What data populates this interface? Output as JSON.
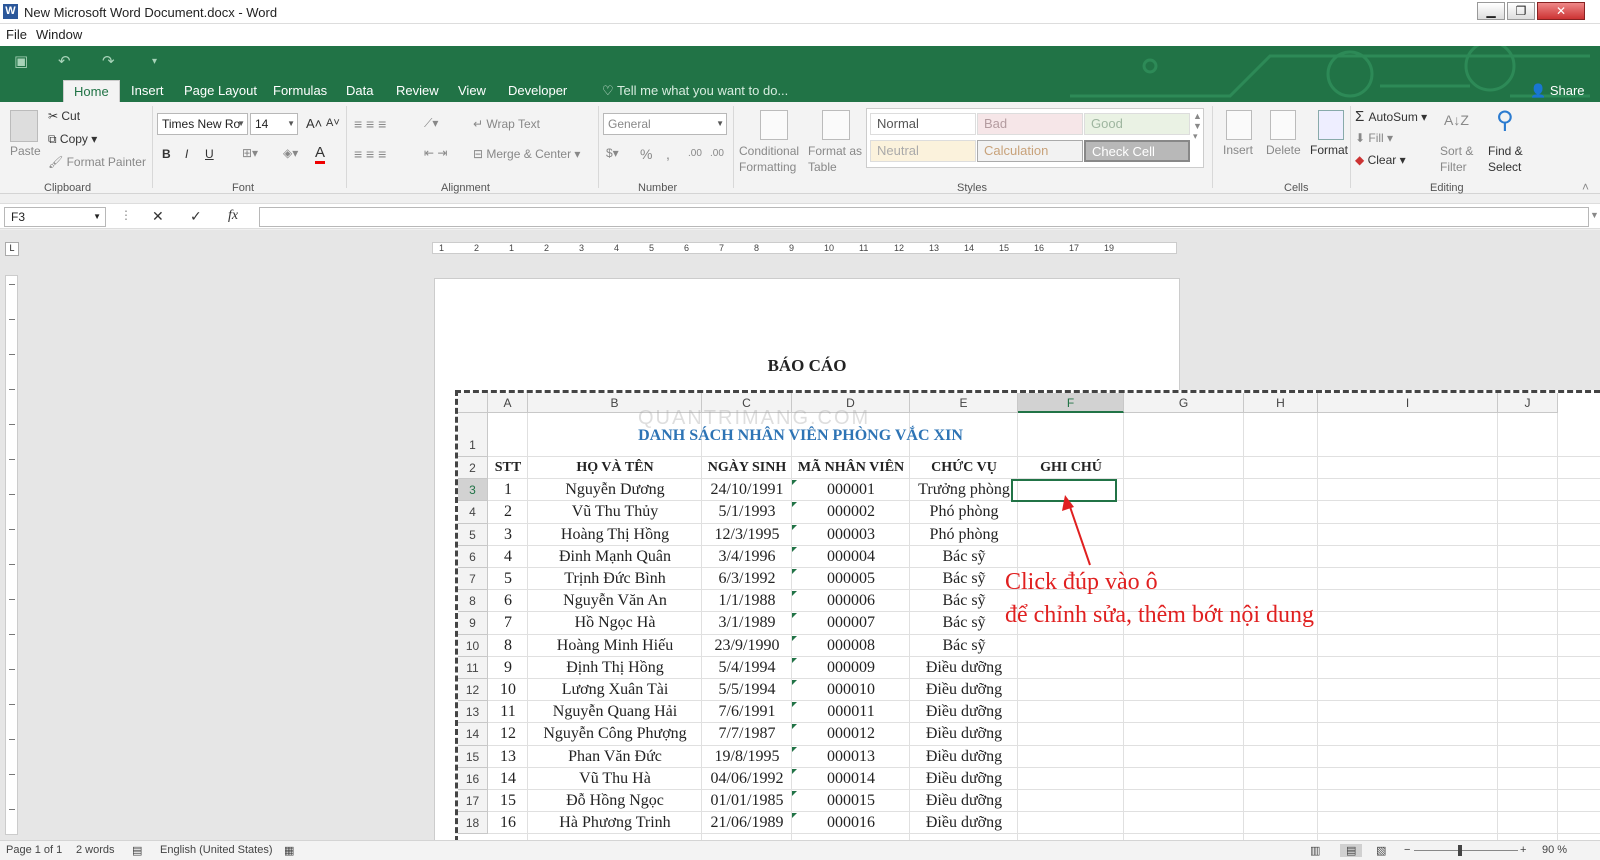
{
  "window": {
    "title": "New Microsoft Word Document.docx - Word"
  },
  "menu": [
    "File",
    "Window"
  ],
  "ribbon_tabs": [
    "Home",
    "Insert",
    "Page Layout",
    "Formulas",
    "Data",
    "Review",
    "View",
    "Developer"
  ],
  "tell_me": "Tell me what you want to do...",
  "share": "Share",
  "clipboard": {
    "paste": "Paste",
    "cut": "Cut",
    "copy": "Copy",
    "format_painter": "Format Painter",
    "group": "Clipboard"
  },
  "font": {
    "name": "Times New Ro",
    "size": "14",
    "bold": "B",
    "italic": "I",
    "underline": "U",
    "color_a": "A",
    "group": "Font"
  },
  "alignment": {
    "wrap_text": "Wrap Text",
    "merge_center": "Merge & Center",
    "group": "Alignment"
  },
  "number": {
    "format": "General",
    "percent": "%",
    "comma": ",",
    "inc": ".00",
    "dec": ".00",
    "group": "Number"
  },
  "styles": {
    "conditional": "Conditional Formatting",
    "format_as_table": "Format as Table",
    "cells": [
      "Normal",
      "Bad",
      "Good",
      "Neutral",
      "Calculation",
      "Check Cell"
    ],
    "group": "Styles"
  },
  "cells_group": {
    "insert": "Insert",
    "delete": "Delete",
    "format": "Format",
    "group": "Cells"
  },
  "editing": {
    "autosum": "AutoSum",
    "fill": "Fill",
    "clear": "Clear",
    "sort": "Sort & Filter",
    "find": "Find & Select",
    "group": "Editing"
  },
  "formula_bar": {
    "name_box": "F3",
    "fx": "fx"
  },
  "ruler_marks": [
    "1",
    "2",
    "1",
    "2",
    "3",
    "4",
    "5",
    "6",
    "7",
    "8",
    "9",
    "10",
    "11",
    "12",
    "13",
    "14",
    "15",
    "16",
    "17",
    "19"
  ],
  "document": {
    "heading": "BÁO CÁO"
  },
  "sheet": {
    "columns": [
      "A",
      "B",
      "C",
      "D",
      "E",
      "F",
      "G",
      "H",
      "I",
      "J"
    ],
    "row_numbers": [
      "1",
      "2",
      "3",
      "4",
      "5",
      "6",
      "7",
      "8",
      "9",
      "10",
      "11",
      "12",
      "13",
      "14",
      "15",
      "16",
      "17",
      "18"
    ],
    "banner": "DANH SÁCH NHÂN VIÊN PHÒNG VẮC XIN",
    "watermark": "QUANTRIMANG.COM",
    "headers": [
      "STT",
      "HỌ VÀ TÊN",
      "NGÀY SINH",
      "MÃ NHÂN VIÊN",
      "CHỨC VỤ",
      "GHI CHÚ"
    ],
    "rows": [
      [
        "1",
        "Nguyễn Dương",
        "24/10/1991",
        "000001",
        "Trưởng phòng"
      ],
      [
        "2",
        "Vũ Thu Thủy",
        "5/1/1993",
        "000002",
        "Phó phòng"
      ],
      [
        "3",
        "Hoàng Thị Hồng",
        "12/3/1995",
        "000003",
        "Phó phòng"
      ],
      [
        "4",
        "Đinh Mạnh Quân",
        "3/4/1996",
        "000004",
        "Bác sỹ"
      ],
      [
        "5",
        "Trịnh Đức Bình",
        "6/3/1992",
        "000005",
        "Bác sỹ"
      ],
      [
        "6",
        "Nguyễn Văn An",
        "1/1/1988",
        "000006",
        "Bác sỹ"
      ],
      [
        "7",
        "Hồ Ngọc Hà",
        "3/1/1989",
        "000007",
        "Bác sỹ"
      ],
      [
        "8",
        "Hoàng Minh Hiếu",
        "23/9/1990",
        "000008",
        "Bác sỹ"
      ],
      [
        "9",
        "Định Thị Hồng",
        "5/4/1994",
        "000009",
        "Điều dưỡng"
      ],
      [
        "10",
        "Lương Xuân Tài",
        "5/5/1994",
        "000010",
        "Điều dưỡng"
      ],
      [
        "11",
        "Nguyễn Quang Hải",
        "7/6/1991",
        "000011",
        "Điều dưỡng"
      ],
      [
        "12",
        "Nguyễn Công Phượng",
        "7/7/1987",
        "000012",
        "Điều dưỡng"
      ],
      [
        "13",
        "Phan Văn Đức",
        "19/8/1995",
        "000013",
        "Điều dưỡng"
      ],
      [
        "14",
        "Vũ Thu Hà",
        "04/06/1992",
        "000014",
        "Điều dưỡng"
      ],
      [
        "15",
        "Đỗ Hồng Ngọc",
        "01/01/1985",
        "000015",
        "Điều dưỡng"
      ],
      [
        "16",
        "Hà Phương Trinh",
        "21/06/1989",
        "000016",
        "Điều dưỡng"
      ]
    ]
  },
  "annotation": {
    "line1": "Click đúp vào ô",
    "line2": "để chỉnh sửa, thêm bớt nội dung"
  },
  "status": {
    "page": "Page 1 of 1",
    "words": "2 words",
    "language": "English (United States)",
    "zoom": "90 %"
  },
  "colors": {
    "excel_green": "#217346",
    "banner_blue": "#2e74b5",
    "annotation_red": "#e02020"
  }
}
